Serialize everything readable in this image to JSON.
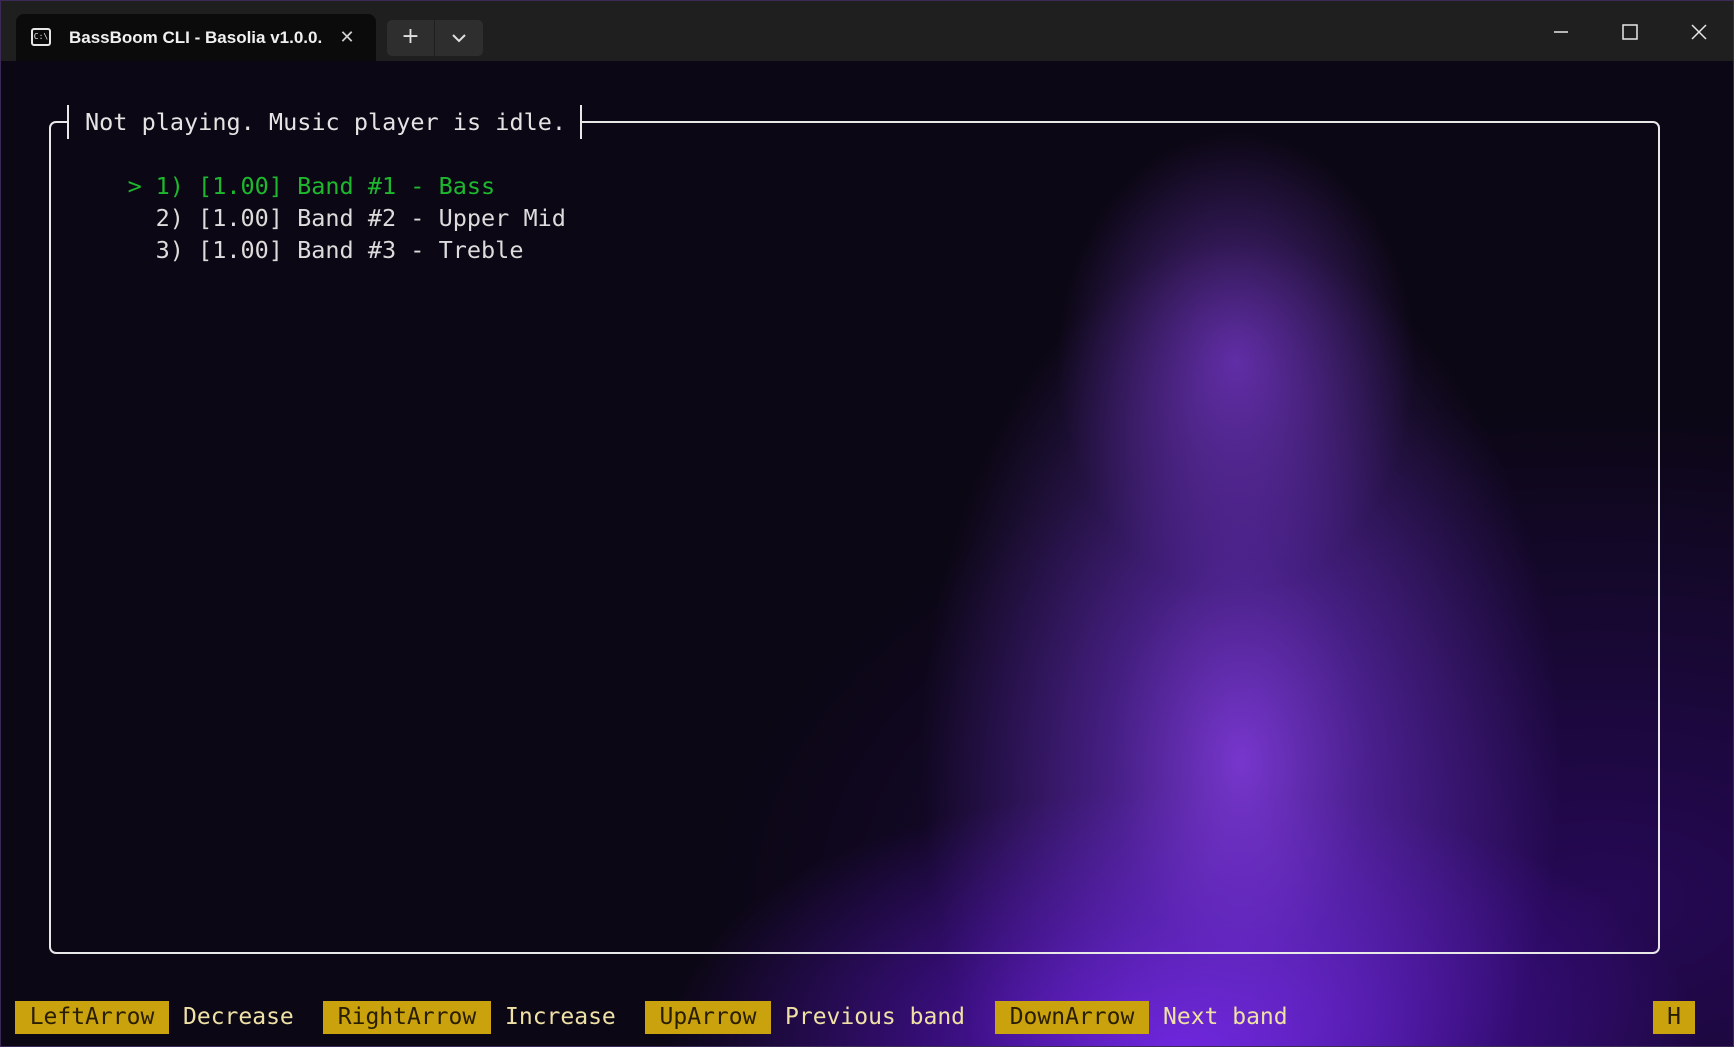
{
  "window": {
    "tab_title": "BassBoom CLI - Basolia v1.0.0.",
    "tab_icon": "terminal-icon",
    "tab_icon_text": "C:\\"
  },
  "terminal": {
    "frame_title": "Not playing. Music player is idle.",
    "cursor": ">",
    "bands": [
      {
        "index": "1)",
        "value": "[1.00]",
        "label": "Band #1 - Bass",
        "selected": true
      },
      {
        "index": "2)",
        "value": "[1.00]",
        "label": "Band #2 - Upper Mid",
        "selected": false
      },
      {
        "index": "3)",
        "value": "[1.00]",
        "label": "Band #3 - Treble",
        "selected": false
      }
    ]
  },
  "keybar": {
    "bindings": [
      {
        "key": "LeftArrow",
        "action": "Decrease"
      },
      {
        "key": "RightArrow",
        "action": "Increase"
      },
      {
        "key": "UpArrow",
        "action": "Previous band"
      },
      {
        "key": "DownArrow",
        "action": "Next band"
      }
    ],
    "help_key": "H"
  },
  "colors": {
    "selected_band": "#1eb82e",
    "key_background": "#c9a20e",
    "key_description": "#efe0a6",
    "accent_glow": "#8a3cff"
  }
}
